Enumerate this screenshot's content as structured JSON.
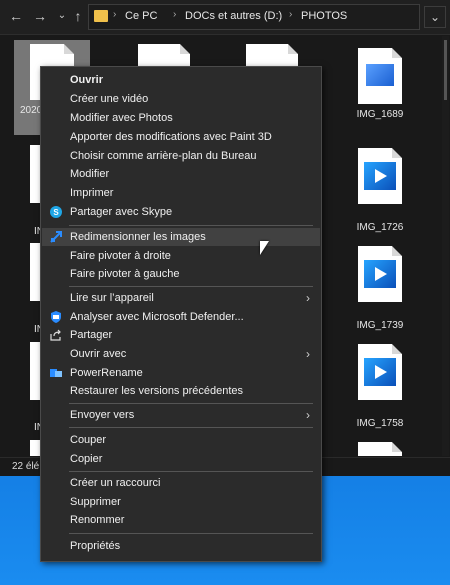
{
  "explorer": {
    "address": [
      "Ce PC",
      "DOCs et autres (D:)",
      "PHOTOS"
    ],
    "status": "22 élé",
    "selected_label": "2020",
    "right_column": [
      {
        "label": "IMG_1689",
        "kind": "photo"
      },
      {
        "label": "IMG_1726",
        "kind": "video"
      },
      {
        "label": "IMG_1739",
        "kind": "video"
      },
      {
        "label": "IMG_1758",
        "kind": "video"
      }
    ],
    "left_fragments": [
      "IN",
      "IN",
      "IN",
      "IN"
    ]
  },
  "context_menu": {
    "items": [
      {
        "label": "Ouvrir",
        "bold": true
      },
      {
        "label": "Créer une vidéo"
      },
      {
        "label": "Modifier avec Photos"
      },
      {
        "label": "Apporter des modifications avec Paint 3D"
      },
      {
        "label": "Choisir comme arrière-plan du Bureau"
      },
      {
        "label": "Modifier"
      },
      {
        "label": "Imprimer"
      },
      {
        "label": "Partager avec Skype",
        "icon": "skype-icon"
      },
      {
        "label": "Redimensionner les images",
        "icon": "resize-icon"
      },
      {
        "label": "Faire pivoter à droite"
      },
      {
        "label": "Faire pivoter à gauche"
      },
      {
        "label": "Lire sur l’appareil",
        "submenu": true
      },
      {
        "label": "Analyser avec Microsoft Defender...",
        "icon": "defender-icon"
      },
      {
        "label": "Partager",
        "icon": "share-icon"
      },
      {
        "label": "Ouvrir avec",
        "submenu": true
      },
      {
        "label": "PowerRename",
        "icon": "powerrename-icon"
      },
      {
        "label": "Restaurer les versions précédentes"
      },
      {
        "label": "Envoyer vers",
        "submenu": true
      },
      {
        "label": "Couper"
      },
      {
        "label": "Copier"
      },
      {
        "label": "Créer un raccourci"
      },
      {
        "label": "Supprimer"
      },
      {
        "label": "Renommer"
      },
      {
        "label": "Propriétés"
      }
    ]
  },
  "colors": {
    "menu_bg": "#2b2b2b",
    "hover_bg": "#414141",
    "accent": "#0a78d7"
  }
}
